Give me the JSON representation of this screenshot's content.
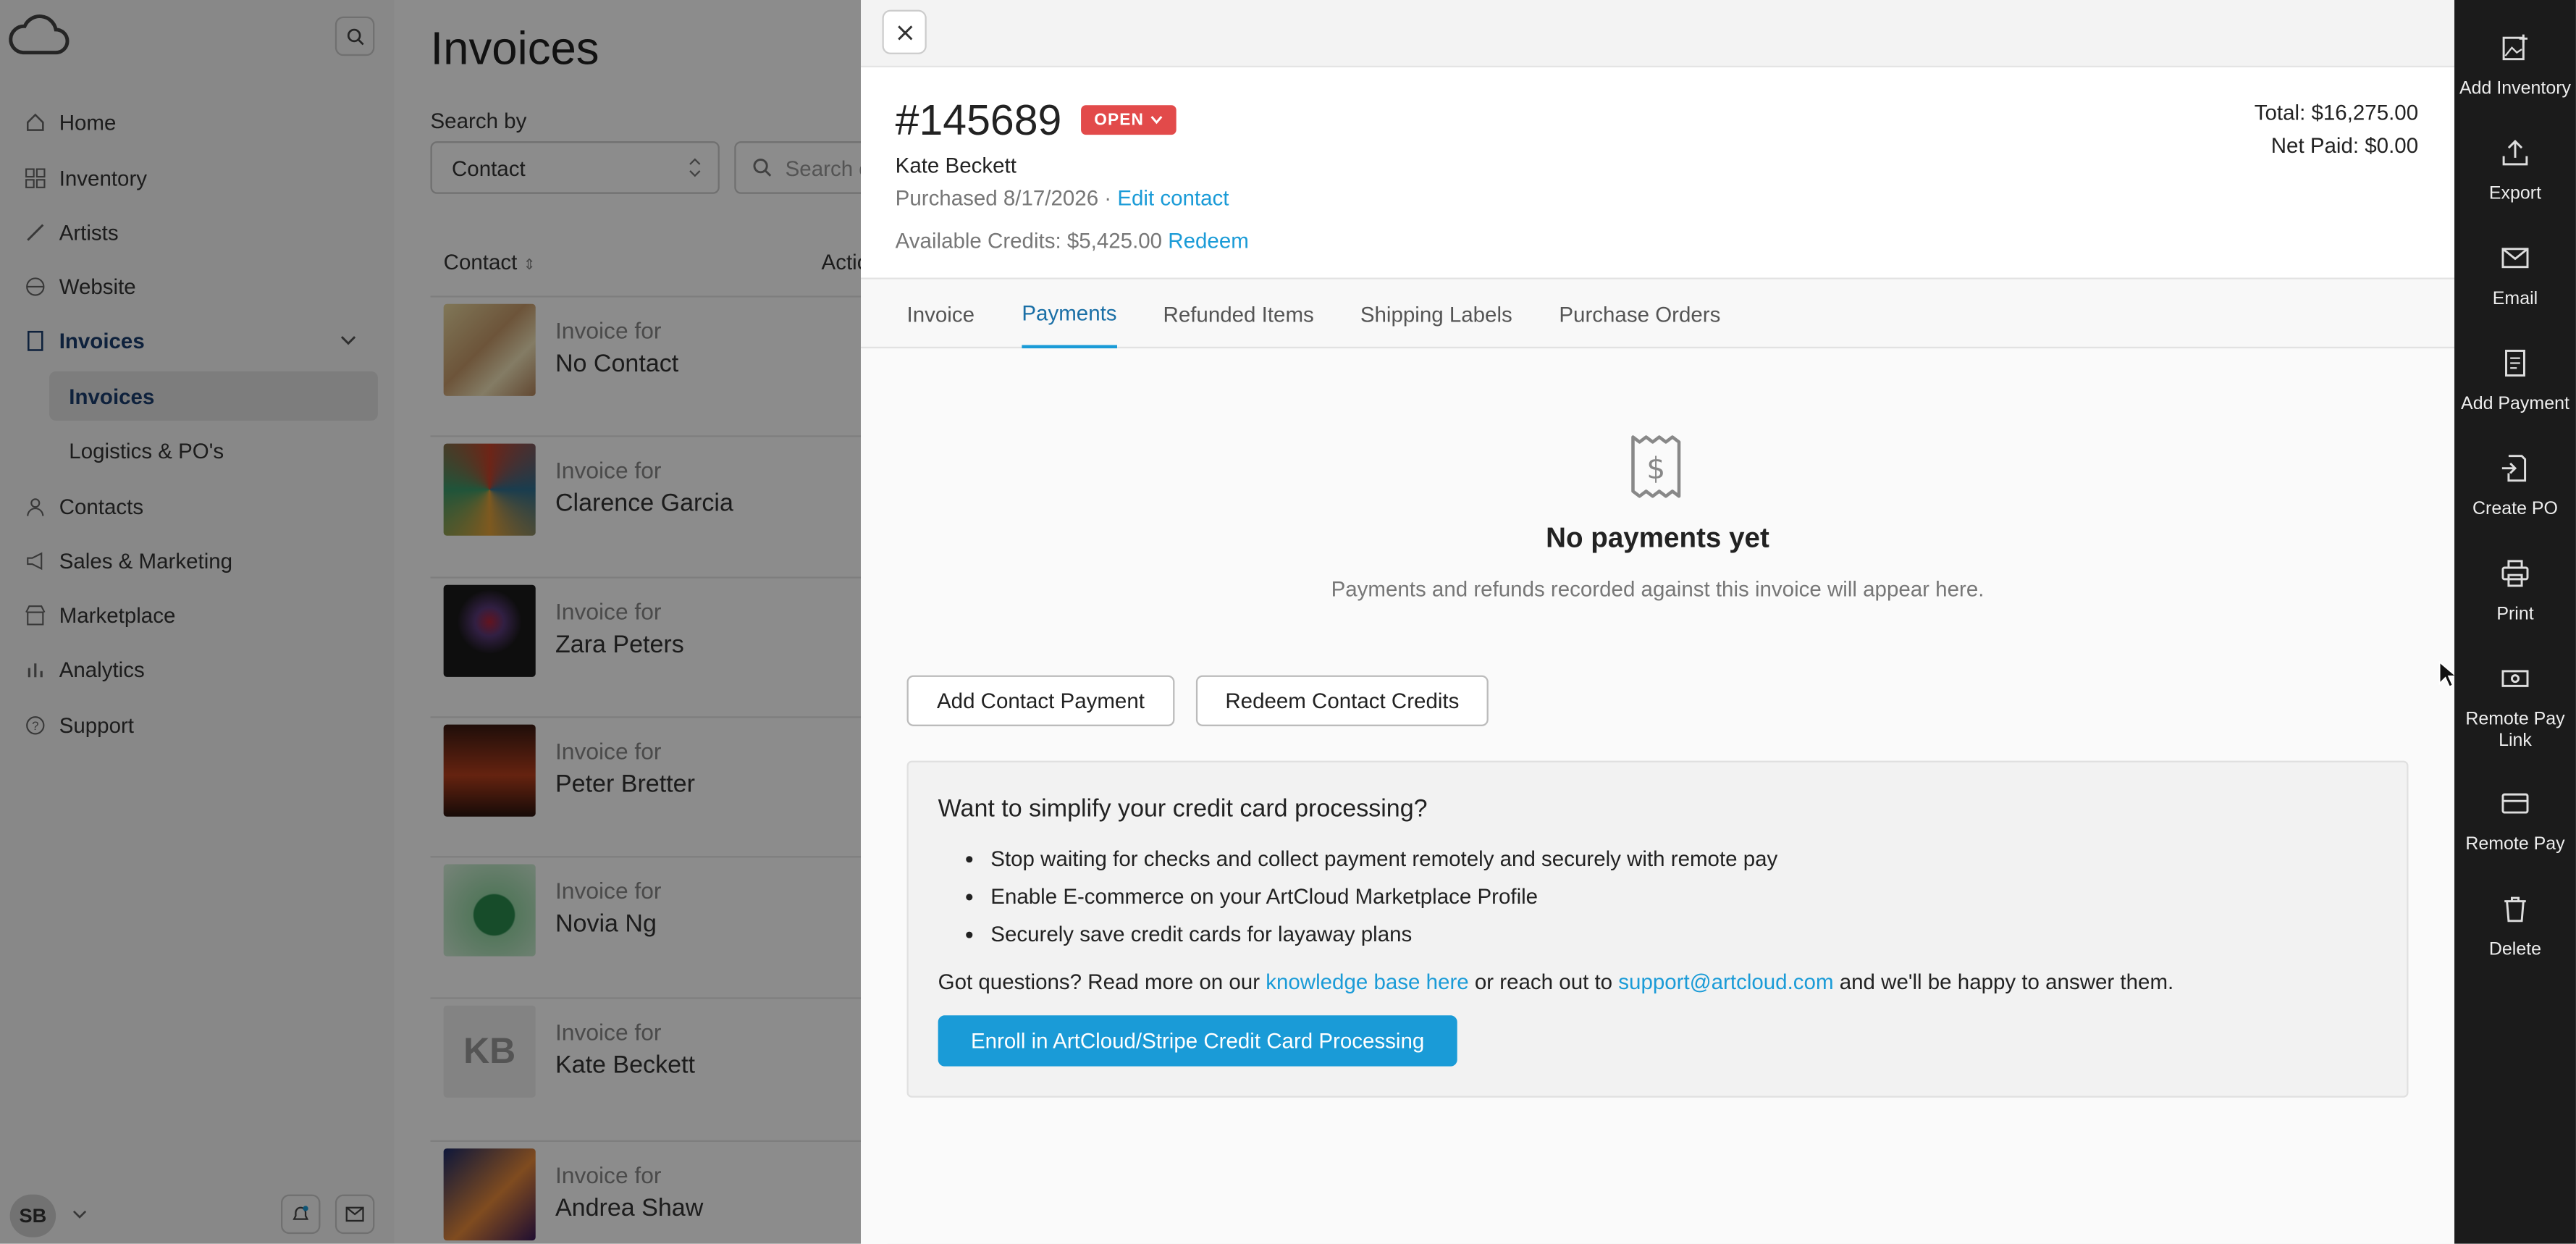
{
  "sidebar": {
    "nav": [
      {
        "label": "Home",
        "icon": "home-icon"
      },
      {
        "label": "Inventory",
        "icon": "grid-icon"
      },
      {
        "label": "Artists",
        "icon": "brush-icon"
      },
      {
        "label": "Website",
        "icon": "globe-icon"
      },
      {
        "label": "Invoices",
        "icon": "document-icon"
      }
    ],
    "sub": [
      {
        "label": "Invoices"
      },
      {
        "label": "Logistics & PO's"
      }
    ],
    "nav2": [
      {
        "label": "Contacts",
        "icon": "user-icon"
      },
      {
        "label": "Sales & Marketing",
        "icon": "megaphone-icon"
      },
      {
        "label": "Marketplace",
        "icon": "store-icon"
      },
      {
        "label": "Analytics",
        "icon": "bar-chart-icon"
      },
      {
        "label": "Support",
        "icon": "help-icon"
      }
    ],
    "user_initials": "SB"
  },
  "list": {
    "title": "Invoices",
    "search_by_label": "Search by",
    "search_by_value": "Contact",
    "search_placeholder": "Search c",
    "col_contact": "Contact",
    "col_actions": "Actio",
    "rows": [
      {
        "label": "Invoice for",
        "name": "No Contact"
      },
      {
        "label": "Invoice for",
        "name": "Clarence Garcia"
      },
      {
        "label": "Invoice for",
        "name": "Zara Peters"
      },
      {
        "label": "Invoice for",
        "name": "Peter Bretter"
      },
      {
        "label": "Invoice for",
        "name": "Novia Ng"
      },
      {
        "label": "Invoice for",
        "name": "Kate Beckett",
        "initials": "KB"
      },
      {
        "label": "Invoice for",
        "name": "Andrea Shaw"
      }
    ]
  },
  "panel": {
    "invoice_number": "#145689",
    "status": "OPEN",
    "customer": "Kate Beckett",
    "purchased": "Purchased 8/17/2026 · ",
    "edit_contact": "Edit contact",
    "credits": "Available Credits: $5,425.00 ",
    "redeem": "Redeem",
    "total": "Total: $16,275.00",
    "net_paid": "Net Paid: $0.00",
    "tabs": [
      "Invoice",
      "Payments",
      "Refunded Items",
      "Shipping Labels",
      "Purchase Orders"
    ],
    "active_tab": "Payments",
    "empty_title": "No payments yet",
    "empty_sub": "Payments and refunds recorded against this invoice will appear here.",
    "btn_add_payment": "Add Contact Payment",
    "btn_redeem_credits": "Redeem Contact Credits",
    "promo": {
      "title": "Want to simplify your credit card processing?",
      "bullets": [
        "Stop waiting for checks and collect payment remotely and securely with remote pay",
        "Enable E-commerce on your ArtCloud Marketplace Profile",
        "Securely save credit cards for layaway plans"
      ],
      "q_pre": "Got questions? Read more on our ",
      "q_link1": "knowledge base here",
      "q_mid": " or reach out to ",
      "q_link2": "support@artcloud.com",
      "q_post": " and we'll be happy to answer them.",
      "enroll": "Enroll in ArtCloud/Stripe Credit Card Processing"
    }
  },
  "actions": [
    {
      "label": "Add Inventory",
      "icon": "add-image-icon"
    },
    {
      "label": "Export",
      "icon": "export-icon"
    },
    {
      "label": "Email",
      "icon": "mail-icon"
    },
    {
      "label": "Add Payment",
      "icon": "receipt-icon"
    },
    {
      "label": "Create PO",
      "icon": "create-po-icon"
    },
    {
      "label": "Print",
      "icon": "printer-icon"
    },
    {
      "label": "Remote Pay Link",
      "icon": "cash-icon"
    },
    {
      "label": "Remote Pay",
      "icon": "card-icon"
    },
    {
      "label": "Delete",
      "icon": "trash-icon"
    }
  ],
  "colors": {
    "accent": "#1a9bd7",
    "status_open": "#e24a4a",
    "action_bar": "#1b1b1b"
  }
}
